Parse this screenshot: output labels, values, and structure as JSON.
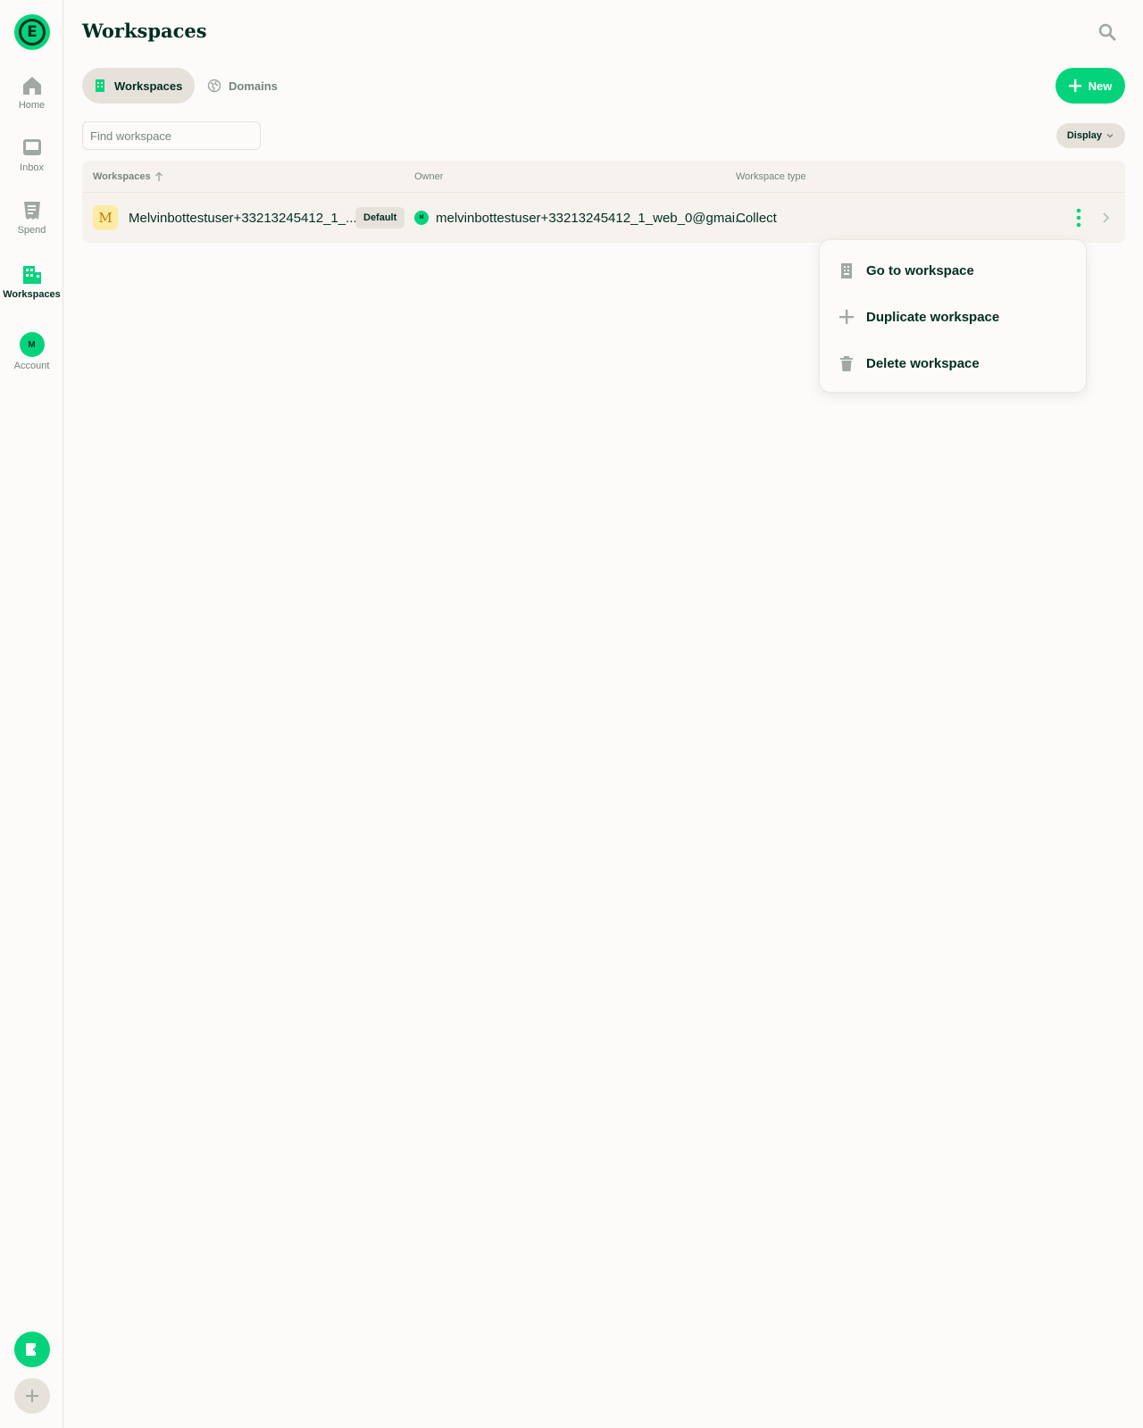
{
  "app": {
    "logo_letter": "E",
    "accent_color": "#03d47c"
  },
  "sidebar": {
    "items": [
      {
        "label": "Home",
        "icon": "home-icon"
      },
      {
        "label": "Inbox",
        "icon": "inbox-icon"
      },
      {
        "label": "Spend",
        "icon": "receipt-icon"
      },
      {
        "label": "Workspaces",
        "icon": "building-icon"
      },
      {
        "label": "Account",
        "icon": "avatar"
      }
    ],
    "account_initial": "M",
    "actions": [
      {
        "icon": "new-expense-icon"
      },
      {
        "icon": "plus-icon"
      }
    ]
  },
  "header": {
    "title": "Workspaces"
  },
  "tabs": [
    {
      "label": "Workspaces",
      "icon": "building-icon",
      "active": true
    },
    {
      "label": "Domains",
      "icon": "globe-icon",
      "active": false
    }
  ],
  "toolbar": {
    "new_label": "New",
    "search_placeholder": "Find workspace",
    "search_value": "",
    "display_label": "Display"
  },
  "table": {
    "columns": [
      "Workspaces",
      "Owner",
      "Workspace type"
    ],
    "rows": [
      {
        "avatar_letter": "M",
        "name": "Melvinbottestuser+33213245412_1_...",
        "badge": "Default",
        "owner_initial": "M",
        "owner": "melvinbottestuser+33213245412_1_web_0@gmai...",
        "type": "Collect"
      }
    ]
  },
  "context_menu": {
    "items": [
      {
        "label": "Go to workspace",
        "icon": "building-icon"
      },
      {
        "label": "Duplicate workspace",
        "icon": "plus-icon"
      },
      {
        "label": "Delete workspace",
        "icon": "trash-icon"
      }
    ]
  }
}
